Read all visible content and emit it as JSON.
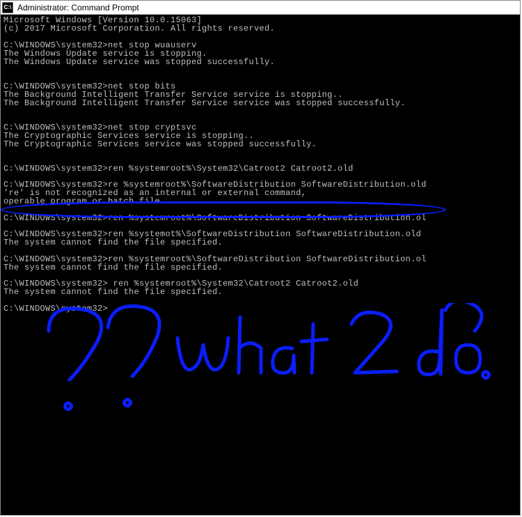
{
  "title_bar": {
    "icon_label": "C:\\",
    "title": "Administrator: Command Prompt"
  },
  "console_lines": [
    "Microsoft Windows [Version 10.0.15063]",
    "(c) 2017 Microsoft Corporation. All rights reserved.",
    "",
    "C:\\WINDOWS\\system32>net stop wuauserv",
    "The Windows Update service is stopping.",
    "The Windows Update service was stopped successfully.",
    "",
    "",
    "C:\\WINDOWS\\system32>net stop bits",
    "The Background Intelligent Transfer Service service is stopping..",
    "The Background Intelligent Transfer Service service was stopped successfully.",
    "",
    "",
    "C:\\WINDOWS\\system32>net stop cryptsvc",
    "The Cryptographic Services service is stopping..",
    "The Cryptographic Services service was stopped successfully.",
    "",
    "",
    "C:\\WINDOWS\\system32>ren %systemroot%\\System32\\Catroot2 Catroot2.old",
    "",
    "C:\\WINDOWS\\system32>re %systemroot%\\SoftwareDistribution SoftwareDistribution.old",
    "'re' is not recognized as an internal or external command,",
    "operable program or batch file.",
    "",
    "C:\\WINDOWS\\system32>ren %systemroot%\\SoftwareDistribution SoftwareDistribution.ol",
    "",
    "C:\\WINDOWS\\system32>ren %systemot%\\SoftwareDistribution SoftwareDistribution.old",
    "The system cannot find the file specified.",
    "",
    "C:\\WINDOWS\\system32>ren %systemroot%\\SoftwareDistribution SoftwareDistribution.ol",
    "The system cannot find the file specified.",
    "",
    "C:\\WINDOWS\\system32> ren %systemroot%\\System32\\Catroot2 Catroot2.old",
    "The system cannot find the file specified.",
    "",
    "C:\\WINDOWS\\system32>"
  ],
  "annotation": {
    "text": "?? what 2 do?",
    "color": "#0a1eff"
  }
}
